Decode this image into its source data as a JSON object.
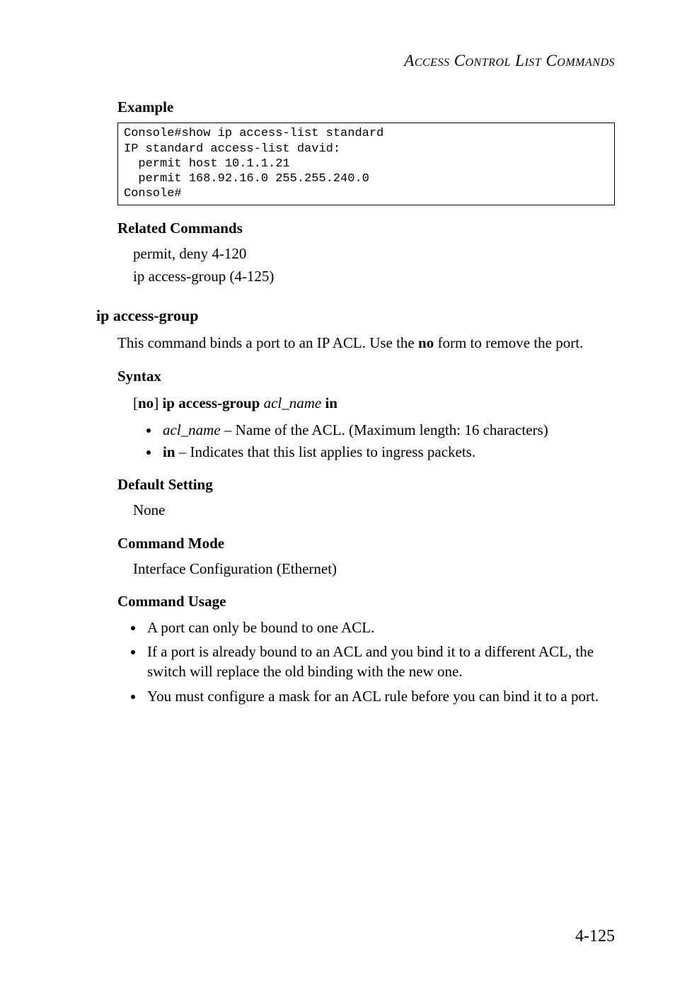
{
  "header": {
    "title_html": "A<span class='sc'>ccess</span> C<span class='sc'>ontrol</span> L<span class='sc'>ist</span> C<span class='sc'>ommands</span>",
    "title_plain": "ACCESS CONTROL LIST COMMANDS"
  },
  "example": {
    "heading": "Example",
    "code": "Console#show ip access-list standard\nIP standard access-list david:\n  permit host 10.1.1.21\n  permit 168.92.16.0 255.255.240.0\nConsole#"
  },
  "related": {
    "heading": "Related Commands",
    "lines": [
      "permit, deny 4-120",
      "ip access-group (4-125)"
    ]
  },
  "command": {
    "title": "ip access-group",
    "description_pre": "This command binds a port to an IP ACL. Use the ",
    "description_bold": "no",
    "description_post": " form to remove the port."
  },
  "syntax": {
    "heading": "Syntax",
    "open_bracket": "[",
    "no": "no",
    "close_bracket": "] ",
    "cmd": "ip access-group",
    "arg": " acl_name ",
    "in": "in",
    "options": [
      {
        "name": "acl_name",
        "name_italic": true,
        "desc": " – Name of the ACL. (Maximum length: 16 characters)"
      },
      {
        "name": "in",
        "name_bold": true,
        "desc": " – Indicates that this list applies to ingress packets."
      }
    ]
  },
  "default": {
    "heading": "Default Setting",
    "value": "None"
  },
  "mode": {
    "heading": "Command Mode",
    "value": "Interface Configuration (Ethernet)"
  },
  "usage": {
    "heading": "Command Usage",
    "items": [
      "A port can only be bound to one ACL.",
      "If a port is already bound to an ACL and you bind it to a different ACL, the switch will replace the old binding with the new one.",
      "You must configure a mask for an ACL rule before you can bind it to a port."
    ]
  },
  "pagenum": "4-125"
}
